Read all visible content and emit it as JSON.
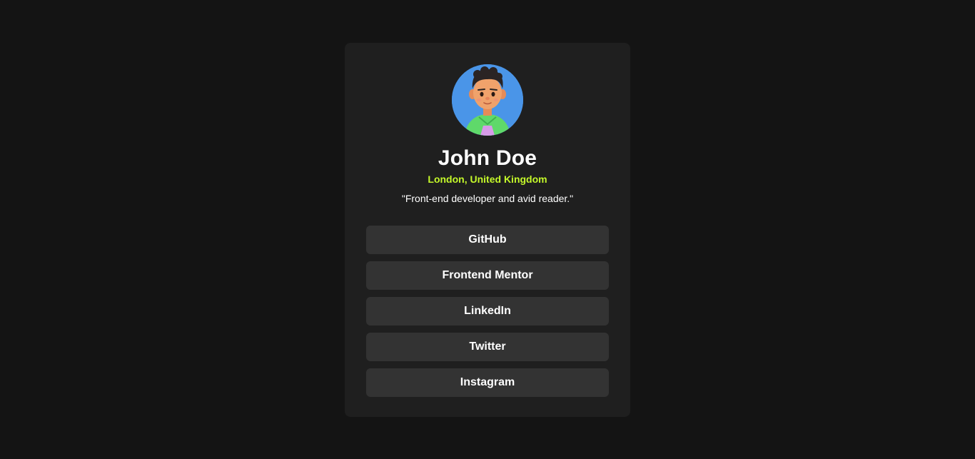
{
  "profile": {
    "name": "John Doe",
    "location": "London, United Kingdom",
    "bio": "\"Front-end developer and avid reader.\"",
    "avatar_icon": "avatar-illustration"
  },
  "links": [
    {
      "label": "GitHub"
    },
    {
      "label": "Frontend Mentor"
    },
    {
      "label": "LinkedIn"
    },
    {
      "label": "Twitter"
    },
    {
      "label": "Instagram"
    }
  ],
  "colors": {
    "background": "#141414",
    "card": "#1f1f1f",
    "button": "#333333",
    "accent": "#c4f82a",
    "avatar_bg": "#4a95e8",
    "text": "#ffffff"
  }
}
